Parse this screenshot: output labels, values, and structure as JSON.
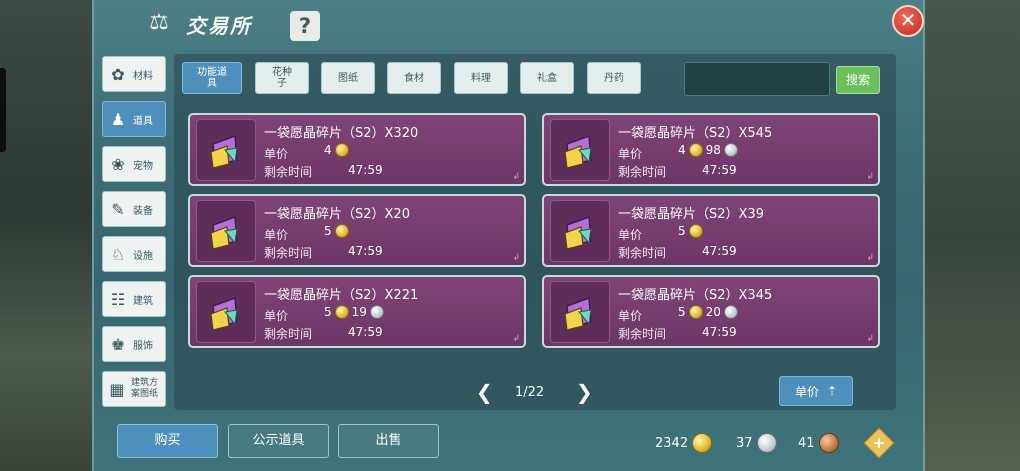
{
  "window": {
    "title": "交易所",
    "help_label": "?",
    "close_label": "✕"
  },
  "categories": [
    {
      "label": "材料",
      "icon": "materials-icon",
      "glyph": "✿",
      "active": false
    },
    {
      "label": "道具",
      "icon": "props-icon",
      "glyph": "♟",
      "active": true
    },
    {
      "label": "宠物",
      "icon": "pet-paw-icon",
      "glyph": "❀",
      "active": false
    },
    {
      "label": "装备",
      "icon": "equipment-icon",
      "glyph": "✎",
      "active": false
    },
    {
      "label": "设施",
      "icon": "facility-icon",
      "glyph": "♘",
      "active": false
    },
    {
      "label": "建筑",
      "icon": "building-icon",
      "glyph": "☷",
      "active": false
    },
    {
      "label": "服饰",
      "icon": "clothing-icon",
      "glyph": "♚",
      "active": false
    },
    {
      "label": "建筑方案图纸",
      "icon": "blueprint-icon",
      "glyph": "▦",
      "active": false
    }
  ],
  "subtabs": [
    {
      "label": "功能道具",
      "active": true
    },
    {
      "label": "花种子",
      "active": false
    },
    {
      "label": "图纸",
      "active": false
    },
    {
      "label": "食材",
      "active": false
    },
    {
      "label": "料理",
      "active": false
    },
    {
      "label": "礼盒",
      "active": false
    },
    {
      "label": "丹药",
      "active": false
    }
  ],
  "search": {
    "value": "",
    "button_label": "搜索"
  },
  "listing_labels": {
    "price": "单价",
    "time": "剩余时间"
  },
  "listings": [
    {
      "name": "一袋愿晶碎片（S2）X320",
      "gold": "4",
      "silver": "",
      "time": "47:59"
    },
    {
      "name": "一袋愿晶碎片（S2）X545",
      "gold": "4",
      "silver": "98",
      "time": "47:59"
    },
    {
      "name": "一袋愿晶碎片（S2）X20",
      "gold": "5",
      "silver": "",
      "time": "47:59"
    },
    {
      "name": "一袋愿晶碎片（S2）X39",
      "gold": "5",
      "silver": "",
      "time": "47:59"
    },
    {
      "name": "一袋愿晶碎片（S2）X221",
      "gold": "5",
      "silver": "19",
      "time": "47:59"
    },
    {
      "name": "一袋愿晶碎片（S2）X345",
      "gold": "5",
      "silver": "20",
      "time": "47:59"
    }
  ],
  "pager": {
    "text": "1/22",
    "prev": "❮",
    "next": "❯"
  },
  "sort": {
    "label": "单价",
    "icon": "sort-arrow-icon"
  },
  "bottom_buttons": {
    "buy": "购买",
    "public": "公示道具",
    "sell": "出售"
  },
  "currencies": {
    "gold": "2342",
    "silver": "37",
    "bronze": "41",
    "add_label": "+"
  },
  "colors": {
    "panel": "#3d6d75",
    "card": "#7f4476",
    "accent_blue": "#4e8fbb",
    "search_green": "#6cc05c",
    "close_red": "#c1271d"
  }
}
